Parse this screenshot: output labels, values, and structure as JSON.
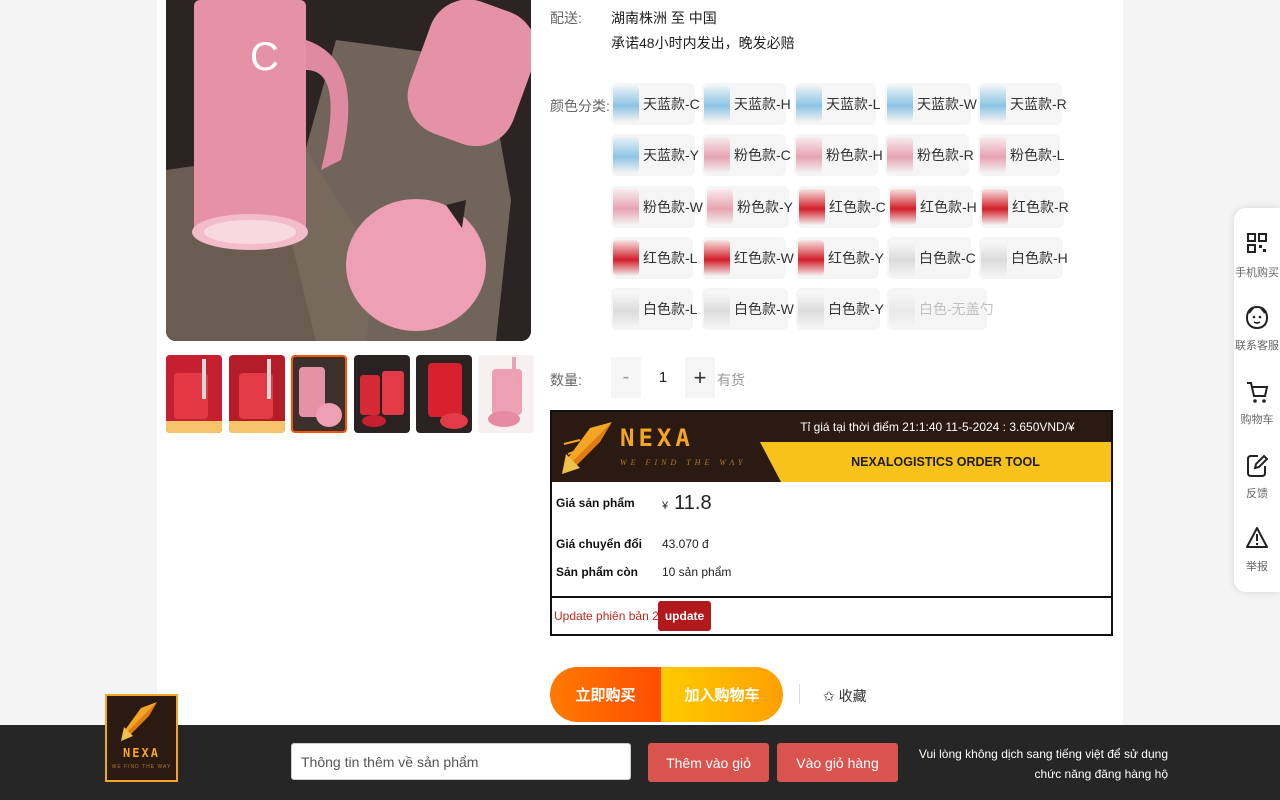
{
  "shipping": {
    "label": "配送:",
    "route": "湖南株洲 至 中国",
    "promise": "承诺48小时内发出，晚发必赔"
  },
  "sku": {
    "label": "颜色分类:",
    "options": [
      {
        "name": "天蓝款-C",
        "swatch": "blue"
      },
      {
        "name": "天蓝款-H",
        "swatch": "blue"
      },
      {
        "name": "天蓝款-L",
        "swatch": "blue"
      },
      {
        "name": "天蓝款-W",
        "swatch": "blue"
      },
      {
        "name": "天蓝款-R",
        "swatch": "blue"
      },
      {
        "name": "天蓝款-Y",
        "swatch": "blue"
      },
      {
        "name": "粉色款-C",
        "swatch": "pink"
      },
      {
        "name": "粉色款-H",
        "swatch": "pink"
      },
      {
        "name": "粉色款-R",
        "swatch": "pink"
      },
      {
        "name": "粉色款-L",
        "swatch": "pink"
      },
      {
        "name": "粉色款-W",
        "swatch": "pink"
      },
      {
        "name": "粉色款-Y",
        "swatch": "pink"
      },
      {
        "name": "红色款-C",
        "swatch": "red"
      },
      {
        "name": "红色款-H",
        "swatch": "red"
      },
      {
        "name": "红色款-R",
        "swatch": "red"
      },
      {
        "name": "红色款-L",
        "swatch": "red"
      },
      {
        "name": "红色款-W",
        "swatch": "red"
      },
      {
        "name": "红色款-Y",
        "swatch": "red"
      },
      {
        "name": "白色款-C",
        "swatch": "white"
      },
      {
        "name": "白色款-H",
        "swatch": "white"
      },
      {
        "name": "白色款-L",
        "swatch": "white"
      },
      {
        "name": "白色款-W",
        "swatch": "white"
      },
      {
        "name": "白色款-Y",
        "swatch": "white"
      },
      {
        "name": "白色-无盖勺",
        "swatch": "white",
        "disabled": true
      }
    ]
  },
  "quantity": {
    "label": "数量:",
    "minus": "-",
    "value": "1",
    "plus": "+",
    "stock": "有货"
  },
  "tool": {
    "brand": "NEXA",
    "brand_tagline": "WE FIND THE WAY",
    "rate_text": "Tỉ giá tại thời điểm 21:1:40 11-5-2024 : 3.650VND/¥",
    "title": "NEXALOGISTICS ORDER TOOL",
    "price_label": "Giá sản phẩm",
    "currency": "¥",
    "price": "11.8",
    "converted_label": "Giá chuyển đổi",
    "converted_value": "43.070 đ",
    "remaining_label": "Sản phẩm còn",
    "remaining_value": "10 sản phẩm",
    "version_text": "Update phiên bản 2.0",
    "update_button": "update"
  },
  "actions": {
    "buy_now": "立即购买",
    "add_to_cart": "加入购物车",
    "favorite": "✩ 收藏"
  },
  "float_bar": [
    {
      "label": "手机购买",
      "icon": "qr-code-icon"
    },
    {
      "label": "联系客服",
      "icon": "chat-service-icon"
    },
    {
      "label": "购物车",
      "icon": "cart-icon"
    },
    {
      "label": "反馈",
      "icon": "feedback-icon"
    },
    {
      "label": "举报",
      "icon": "report-icon"
    }
  ],
  "bottom_bar": {
    "logo_text": "NEXA",
    "logo_tagline": "WE FIND THE WAY",
    "input_value": "Thông tin thêm về sản phẩm",
    "add_to_cart_button": "Thêm vào giỏ",
    "go_to_cart_button": "Vào giỏ hàng",
    "note": "Vui lòng không dịch sang tiếng việt để sử dụng chức năng đăng hàng hộ"
  },
  "colors": {
    "accent_orange": "#ff5000",
    "price_red": "#e2231a",
    "brand_gold": "#f5a524",
    "tool_yellow": "#f8c21c",
    "bottom_button": "#d9534f"
  }
}
